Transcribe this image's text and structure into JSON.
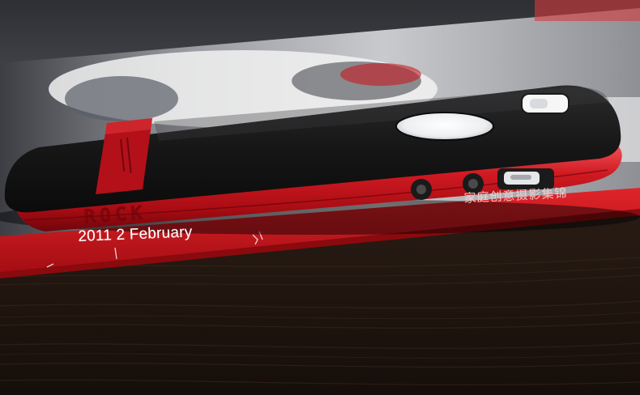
{
  "magazine": {
    "date_text": "2011 2 February",
    "cjk_text": "家庭创意摄影集锦"
  },
  "case": {
    "brand_mark": "ROCK"
  },
  "colors": {
    "bumper_red": "#c3121c",
    "case_black": "#141414",
    "magazine_red": "#c8141a",
    "wood_dark": "#1e1611"
  }
}
